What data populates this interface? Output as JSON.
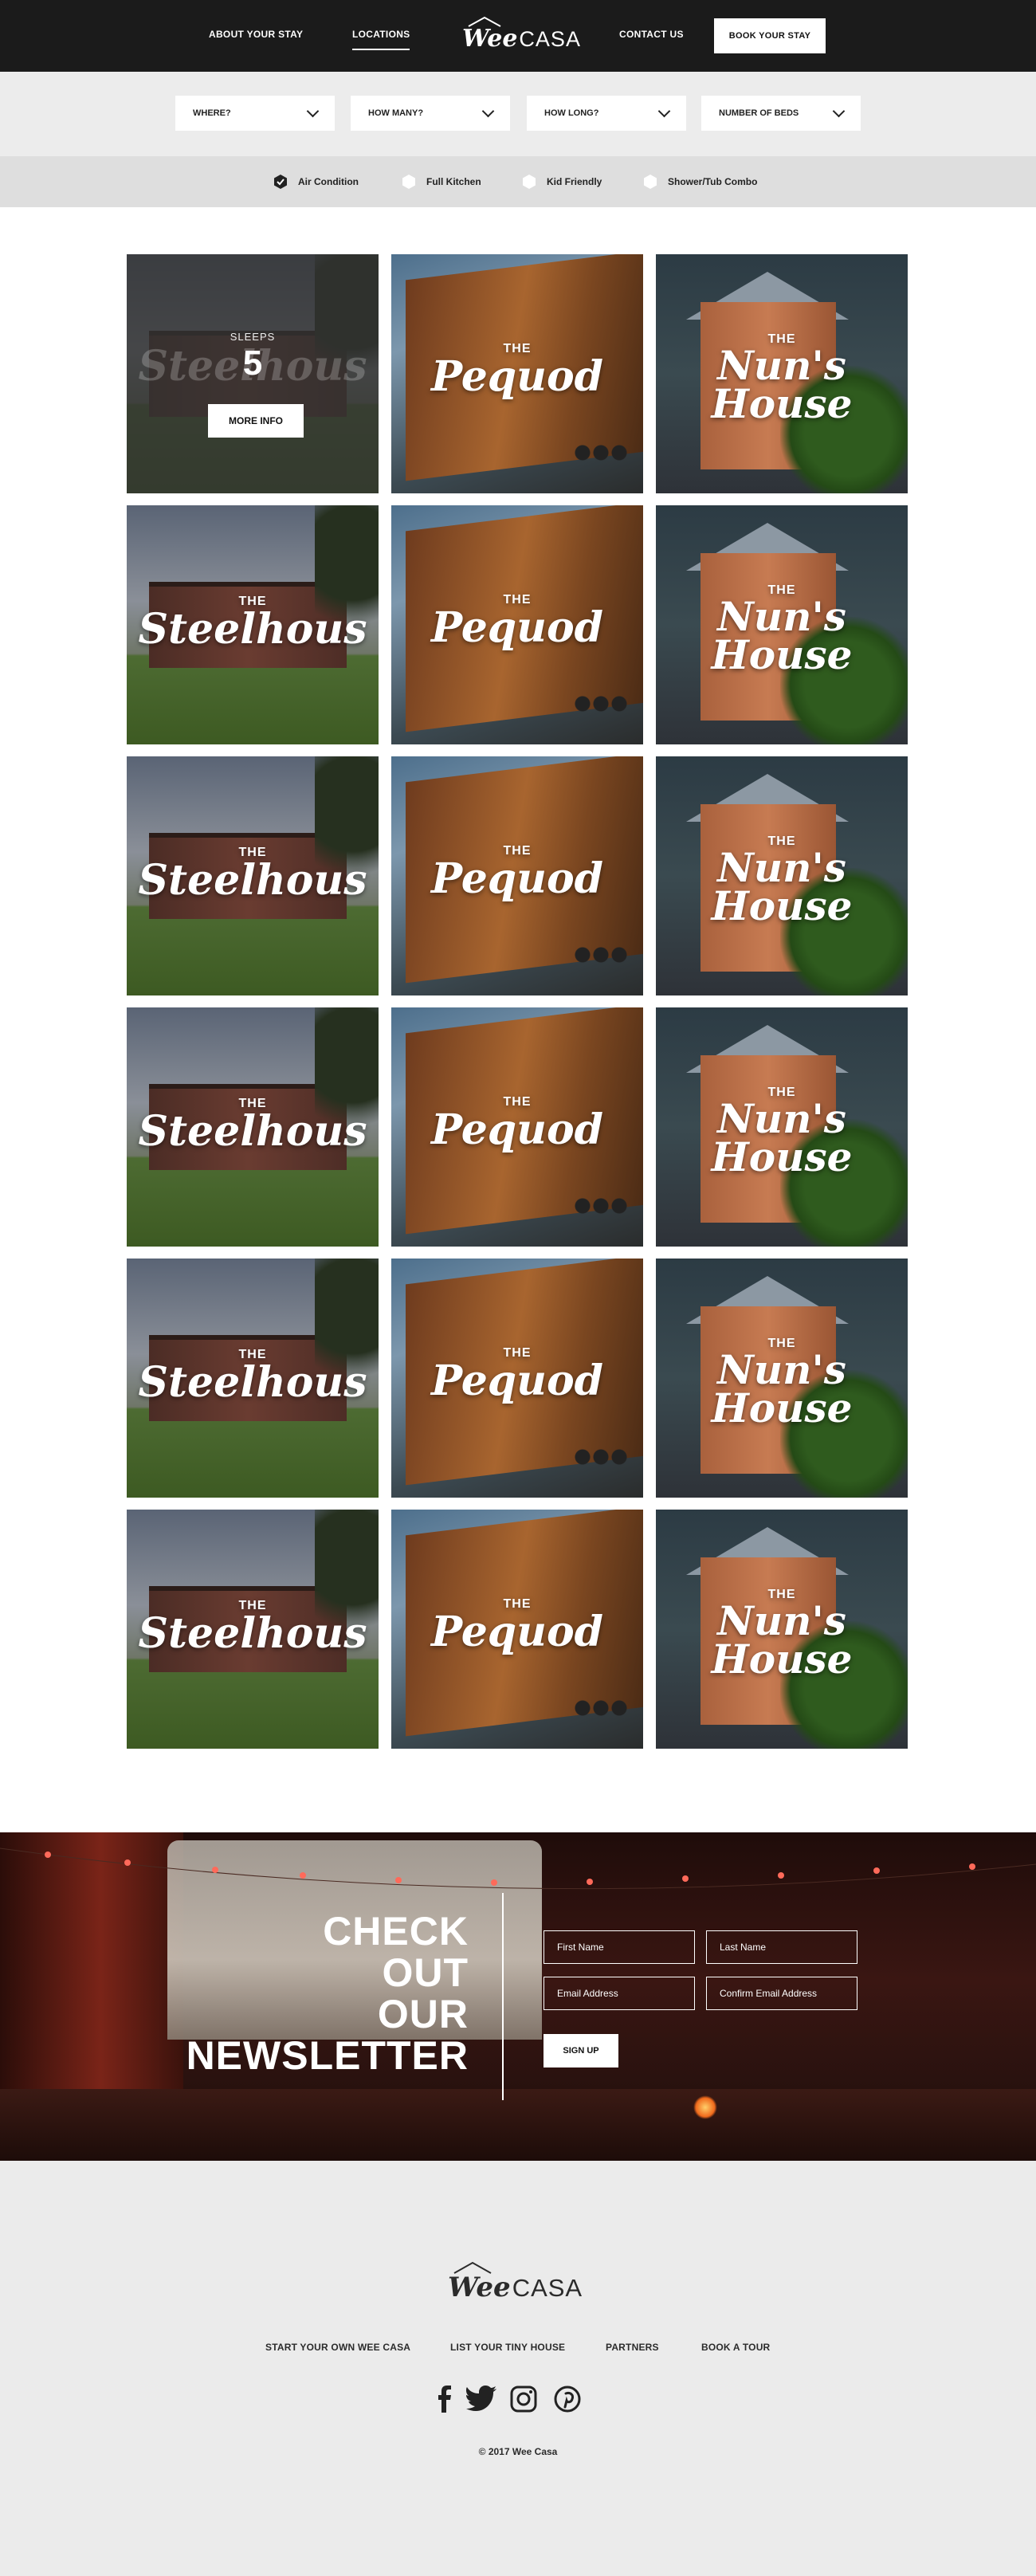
{
  "nav": {
    "about": "ABOUT YOUR STAY",
    "locations": "LOCATIONS",
    "logo_wee": "Wee",
    "logo_casa": "CASA",
    "contact": "CONTACT US",
    "book": "BOOK YOUR STAY"
  },
  "filters": {
    "where": "WHERE?",
    "how_many": "HOW MANY?",
    "how_long": "HOW LONG?",
    "beds": "NUMBER OF BEDS"
  },
  "amenities": [
    {
      "label": "Air Condition",
      "checked": true
    },
    {
      "label": "Full Kitchen",
      "checked": false
    },
    {
      "label": "Kid Friendly",
      "checked": false
    },
    {
      "label": "Shower/Tub Combo",
      "checked": false
    }
  ],
  "listings": {
    "the": "THE",
    "steelhous": "Steelhous",
    "pequod": "Pequod",
    "nuns_line1": "Nun's",
    "nuns_line2": "House",
    "overlay": {
      "sleeps_label": "SLEEPS",
      "sleeps_value": "5",
      "more_info": "MORE INFO"
    }
  },
  "newsletter": {
    "line1": "CHECK",
    "line2": "OUT",
    "line3": "OUR",
    "line4": "NEWSLETTER",
    "first_name": "First Name",
    "last_name": "Last Name",
    "email": "Email Address",
    "confirm_email": "Confirm Email Address",
    "signup": "SIGN UP"
  },
  "footer": {
    "logo_wee": "Wee",
    "logo_casa": "CASA",
    "links": [
      "START YOUR OWN WEE CASA",
      "LIST YOUR TINY HOUSE",
      "PARTNERS",
      "BOOK A TOUR"
    ],
    "social": [
      "facebook-icon",
      "twitter-icon",
      "instagram-icon",
      "pinterest-icon"
    ],
    "copyright": "© 2017 Wee Casa"
  }
}
